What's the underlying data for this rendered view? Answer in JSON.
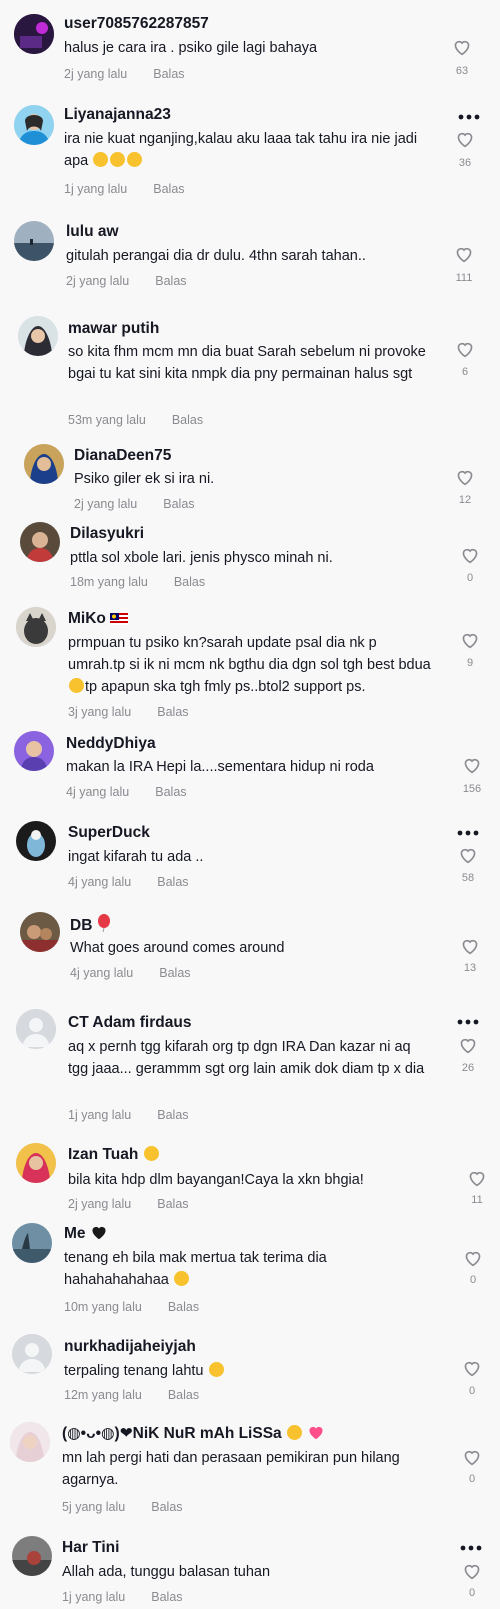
{
  "colors": {
    "background": "#f8f8f8",
    "text": "#161823",
    "meta": "#8a8b91"
  },
  "reply_label": "Balas",
  "comments": [
    {
      "username": "user7085762287857",
      "text": "halus je cara ira . psiko gile lagi bahaya",
      "time": "2j yang lalu",
      "likes": "63"
    },
    {
      "username": "Liyanajanna23",
      "text": "ira nie kuat nganjing,kalau aku laaa tak tahu ira nie jadi apa",
      "time": "1j yang lalu",
      "likes": "36"
    },
    {
      "username": "lulu aw",
      "text": "gitulah perangai dia dr dulu. 4thn sarah tahan..",
      "time": "2j yang lalu",
      "likes": "111"
    },
    {
      "username": "mawar putih",
      "text": "so kita fhm mcm mn dia buat Sarah sebelum ni provoke bgai tu kat sini kita nmpk dia pny permainan halus sgt",
      "time": "53m yang lalu",
      "likes": "6"
    },
    {
      "username": "DianaDeen75",
      "text": "Psiko giler ek si ira ni.",
      "time": "2j yang lalu",
      "likes": "12"
    },
    {
      "username": "Dilasyukri",
      "text": "pttla sol xbole lari. jenis physco minah ni.",
      "time": "18m yang lalu",
      "likes": "0"
    },
    {
      "username": "MiKo",
      "text_a": "prmpuan tu psiko kn?sarah update psal dia nk p umrah.tp si ik ni mcm nk bgthu dia dgn sol tgh best bdua",
      "text_b": "tp apapun ska tgh fmly ps..btol2 support ps.",
      "time": "3j yang lalu",
      "likes": "9"
    },
    {
      "username": "NeddyDhiya",
      "text": "makan la IRA Hepi la....sementara hidup ni roda",
      "time": "4j yang lalu",
      "likes": "156"
    },
    {
      "username": "SuperDuck",
      "text": "ingat kifarah tu ada ..",
      "time": "4j yang lalu",
      "likes": "58"
    },
    {
      "username": "DB",
      "text": "What goes around comes around",
      "time": "4j yang lalu",
      "likes": "13"
    },
    {
      "username": "CT Adam firdaus",
      "text": "aq x pernh tgg kifarah org tp dgn IRA Dan kazar ni aq tgg jaaa... gerammm sgt org lain amik dok diam tp x dia",
      "time": "1j yang lalu",
      "likes": "26"
    },
    {
      "username": "Izan Tuah",
      "text": "bila kita hdp dlm bayangan!Caya la xkn bhgia!",
      "time": "2j yang lalu",
      "likes": "11"
    },
    {
      "username": "Me",
      "text": "tenang eh bila mak mertua tak terima dia hahahahahahaa",
      "time": "10m yang lalu",
      "likes": "0"
    },
    {
      "username": "nurkhadijaheiyjah",
      "text": "terpaling tenang lahtu",
      "time": "12m yang lalu",
      "likes": "0"
    },
    {
      "username": "(◍•ᴗ•◍)❤NiK NuR mAh LiSSa",
      "text": "mn lah pergi hati dan perasaan pemikiran pun hilang agarnya.",
      "time": "5j yang lalu",
      "likes": "0"
    },
    {
      "username": "Har Tini",
      "text": "Allah ada, tunggu balasan tuhan",
      "time": "1j yang lalu",
      "likes": "0"
    }
  ]
}
